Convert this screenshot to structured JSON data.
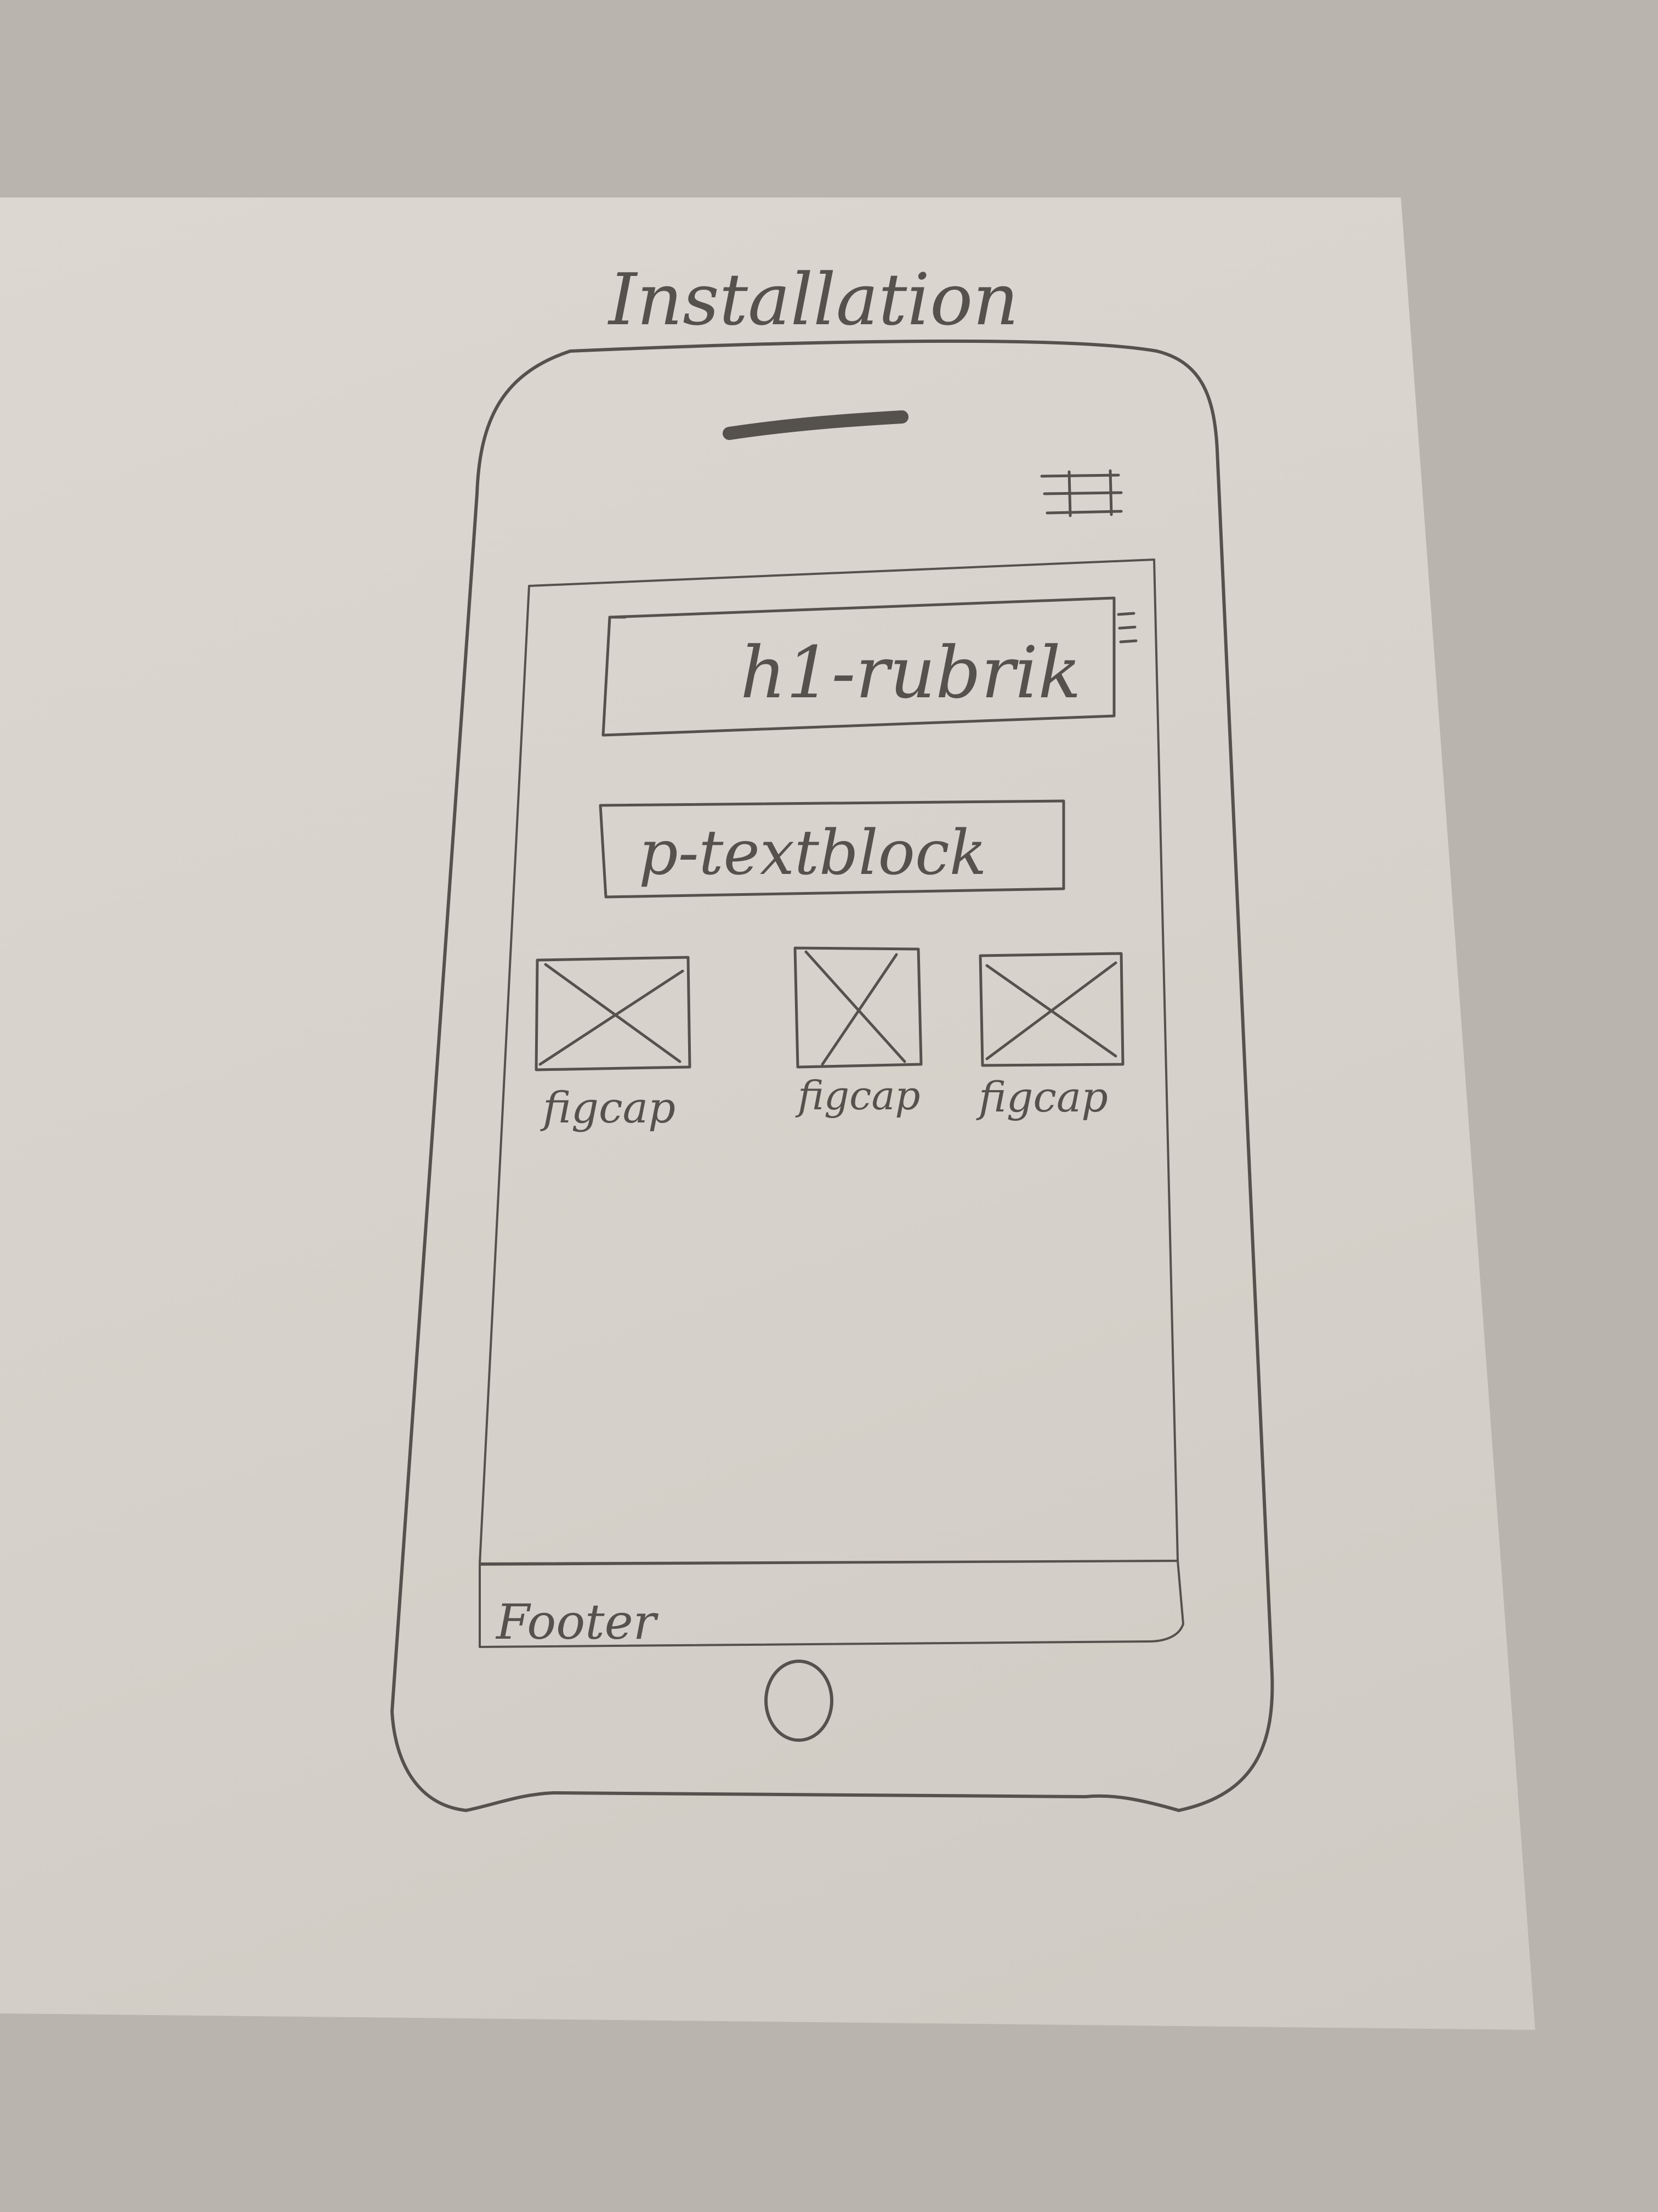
{
  "title": "Installation",
  "sketch": {
    "header": "h1-rubrik",
    "paragraph": "p-textblock",
    "figures": [
      {
        "caption": "figcap"
      },
      {
        "caption": "figcap"
      },
      {
        "caption": "figcap"
      }
    ],
    "footer": "Footer",
    "icons": {
      "phone_menu": "hamburger-menu-icon",
      "header_menu": "hamburger-menu-icon",
      "image_placeholder": "image-placeholder-icon",
      "home_button": "home-button-icon",
      "speaker": "speaker-icon"
    }
  },
  "colors": {
    "paper": "#d8d3cc",
    "background": "#b9b4ad",
    "pencil": "#55514c"
  }
}
